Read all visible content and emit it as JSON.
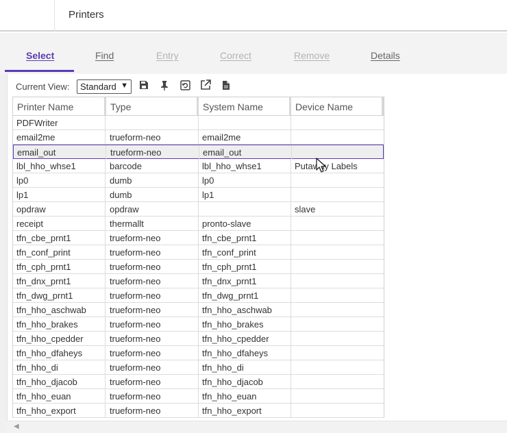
{
  "header": {
    "title": "Printers"
  },
  "tabs": [
    {
      "label": "Select",
      "state": "active"
    },
    {
      "label": "Find",
      "state": "enabled"
    },
    {
      "label": "Entry",
      "state": "disabled"
    },
    {
      "label": "Correct",
      "state": "disabled"
    },
    {
      "label": "Remove",
      "state": "disabled"
    },
    {
      "label": "Details",
      "state": "enabled"
    }
  ],
  "toolbar": {
    "current_view_label": "Current View:",
    "view_value": "Standard",
    "icons": [
      "save-icon",
      "pin-icon",
      "restore-icon",
      "export-icon",
      "document-icon"
    ]
  },
  "grid": {
    "columns": [
      "Printer Name",
      "Type",
      "System Name",
      "Device Name"
    ],
    "selected_row": 2,
    "rows": [
      [
        "PDFWriter",
        "",
        "",
        ""
      ],
      [
        "email2me",
        "trueform-neo",
        "email2me",
        ""
      ],
      [
        "email_out",
        "trueform-neo",
        "email_out",
        ""
      ],
      [
        "lbl_hho_whse1",
        "barcode",
        "lbl_hho_whse1",
        "Putaway Labels"
      ],
      [
        "lp0",
        "dumb",
        "lp0",
        ""
      ],
      [
        "lp1",
        "dumb",
        "lp1",
        ""
      ],
      [
        "opdraw",
        "opdraw",
        "",
        "slave"
      ],
      [
        "receipt",
        "thermallt",
        "pronto-slave",
        ""
      ],
      [
        "tfn_cbe_prnt1",
        "trueform-neo",
        "tfn_cbe_prnt1",
        ""
      ],
      [
        "tfn_conf_print",
        "trueform-neo",
        "tfn_conf_print",
        ""
      ],
      [
        "tfn_cph_prnt1",
        "trueform-neo",
        "tfn_cph_prnt1",
        ""
      ],
      [
        "tfn_dnx_prnt1",
        "trueform-neo",
        "tfn_dnx_prnt1",
        ""
      ],
      [
        "tfn_dwg_prnt1",
        "trueform-neo",
        "tfn_dwg_prnt1",
        ""
      ],
      [
        "tfn_hho_aschwab",
        "trueform-neo",
        "tfn_hho_aschwab",
        ""
      ],
      [
        "tfn_hho_brakes",
        "trueform-neo",
        "tfn_hho_brakes",
        ""
      ],
      [
        "tfn_hho_cpedder",
        "trueform-neo",
        "tfn_hho_cpedder",
        ""
      ],
      [
        "tfn_hho_dfaheys",
        "trueform-neo",
        "tfn_hho_dfaheys",
        ""
      ],
      [
        "tfn_hho_di",
        "trueform-neo",
        "tfn_hho_di",
        ""
      ],
      [
        "tfn_hho_djacob",
        "trueform-neo",
        "tfn_hho_djacob",
        ""
      ],
      [
        "tfn_hho_euan",
        "trueform-neo",
        "tfn_hho_euan",
        ""
      ],
      [
        "tfn_hho_export",
        "trueform-neo",
        "tfn_hho_export",
        ""
      ]
    ]
  },
  "colors": {
    "accent": "#5b3bb3",
    "selected_row_bg": "#eeeeee"
  }
}
